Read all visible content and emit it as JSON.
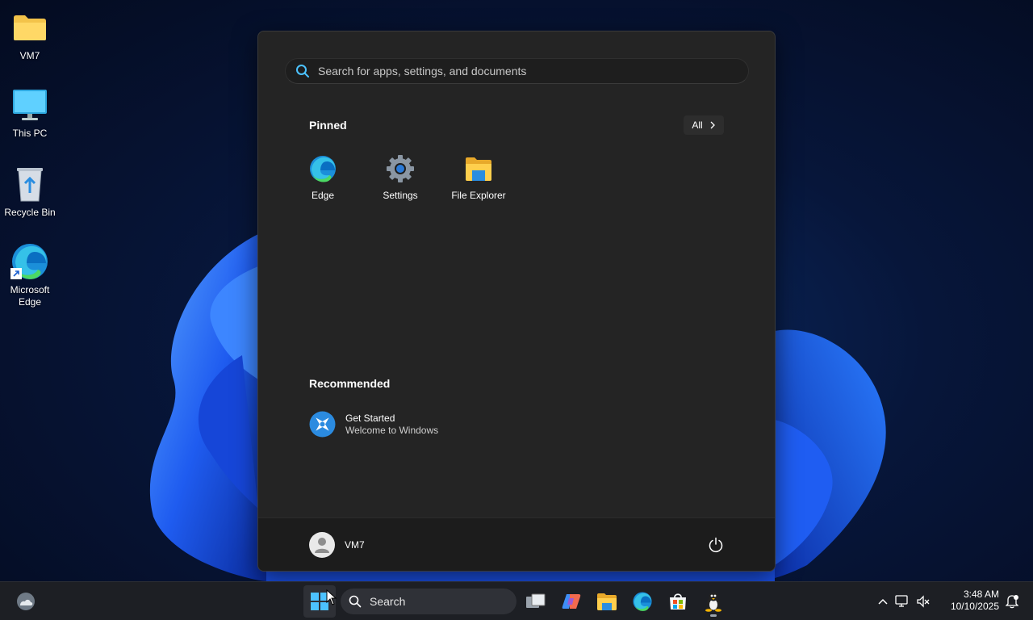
{
  "desktop": {
    "icons": [
      {
        "label": "VM7",
        "icon": "folder-icon"
      },
      {
        "label": "This PC",
        "icon": "monitor-icon"
      },
      {
        "label": "Recycle Bin",
        "icon": "recycle-bin-icon"
      },
      {
        "label": "Microsoft Edge",
        "icon": "edge-icon"
      }
    ]
  },
  "start_menu": {
    "search_placeholder": "Search for apps, settings, and documents",
    "pinned_title": "Pinned",
    "all_label": "All",
    "pinned": [
      {
        "label": "Edge",
        "icon": "edge-icon"
      },
      {
        "label": "Settings",
        "icon": "gear-icon"
      },
      {
        "label": "File Explorer",
        "icon": "folder-icon"
      }
    ],
    "recommended_title": "Recommended",
    "recommended": [
      {
        "title": "Get Started",
        "subtitle": "Welcome to Windows",
        "icon": "get-started-icon"
      }
    ],
    "user_name": "VM7"
  },
  "taskbar": {
    "search_label": "Search",
    "apps": [
      "start-icon",
      "task-view-icon",
      "copilot-icon",
      "file-explorer-icon",
      "edge-icon",
      "store-icon",
      "linux-icon"
    ],
    "time": "3:48 AM",
    "date": "10/10/2025"
  },
  "colors": {
    "start_bg": "#242424",
    "taskbar_bg": "#1d1f24",
    "accent": "#4cc2ff"
  }
}
